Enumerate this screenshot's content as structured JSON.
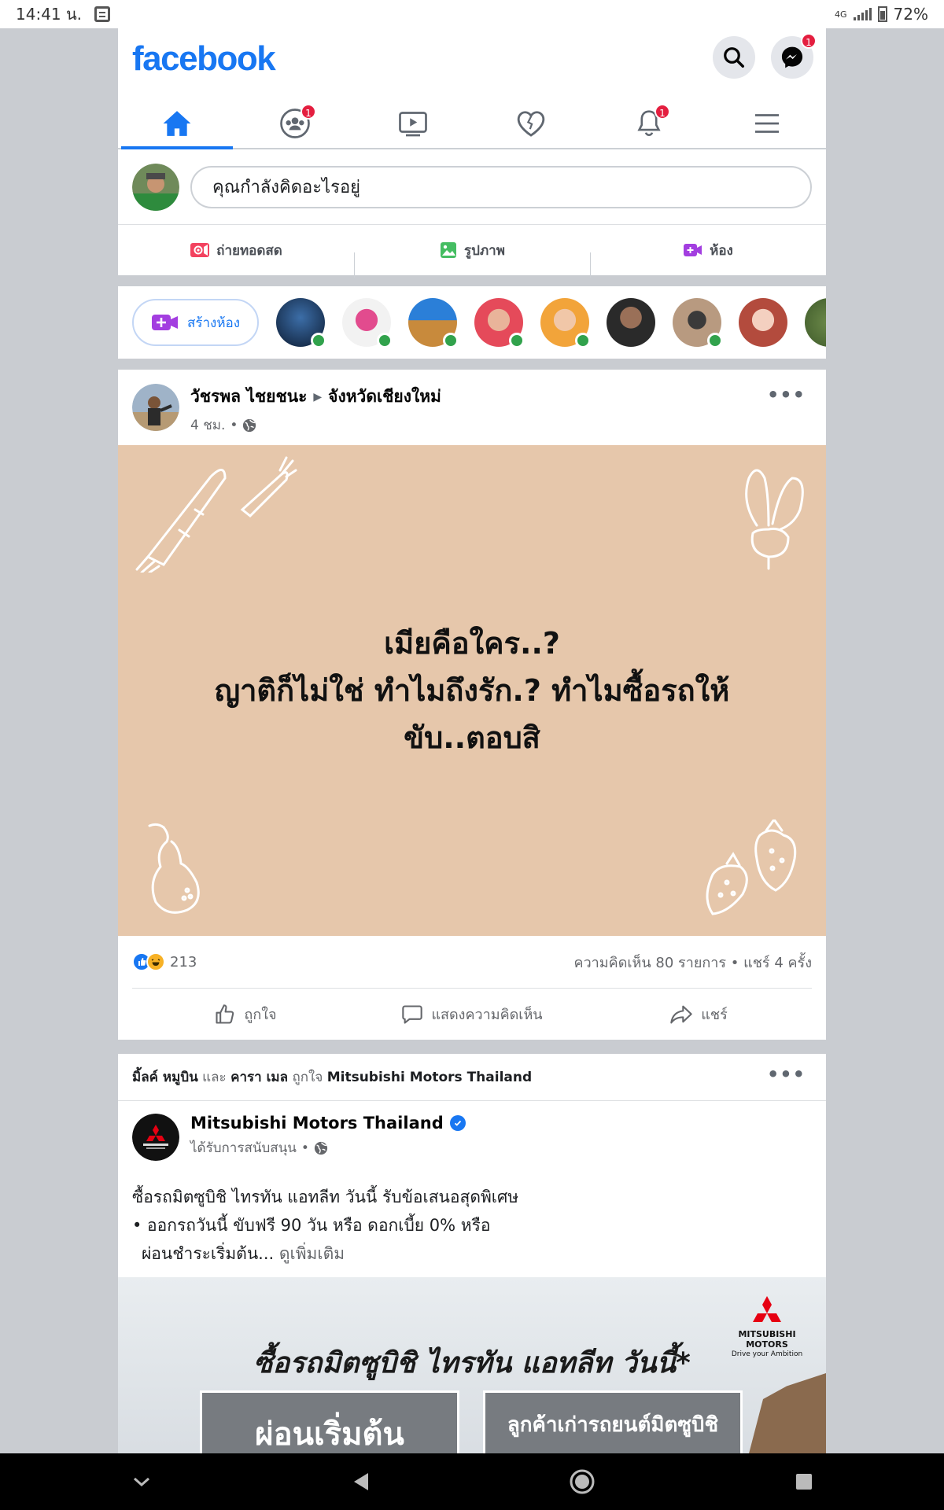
{
  "status_bar": {
    "time": "14:41 น.",
    "network": "4G",
    "battery": "72%"
  },
  "header": {
    "logo": "facebook",
    "messenger_badge": "1",
    "tabs": [
      {
        "name": "home",
        "badge": ""
      },
      {
        "name": "groups",
        "badge": "1"
      },
      {
        "name": "watch",
        "badge": ""
      },
      {
        "name": "dating",
        "badge": ""
      },
      {
        "name": "notifications",
        "badge": "1"
      },
      {
        "name": "menu",
        "badge": ""
      }
    ]
  },
  "composer": {
    "placeholder": "คุณกำลังคิดอะไรอยู่",
    "actions": [
      "ถ่ายทอดสด",
      "รูปภาพ",
      "ห้อง"
    ]
  },
  "rooms": {
    "create_label": "สร้างห้อง"
  },
  "post1": {
    "author": "วัชรพล ไชยชนะ",
    "location": "จังหวัดเชียงใหม่",
    "time": "4 ชม.",
    "text_lines": [
      "เมียคือใคร..?",
      "ญาติก็ไม่ใช่ ทำไมถึงรัก.? ทำไมซื้อรถให้",
      "ขับ..ตอบสิ"
    ],
    "reaction_count": "213",
    "comments_shares": "ความคิดเห็น 80 รายการ • แชร์ 4 ครั้ง",
    "actions": [
      "ถูกใจ",
      "แสดงความคิดเห็น",
      "แชร์"
    ]
  },
  "post2": {
    "liked_by_1": "มิ้ลค์ หมูบิน",
    "liked_by_and": "และ",
    "liked_by_2": "คารา เมล",
    "liked_verb": "ถูกใจ",
    "liked_page": "Mitsubishi Motors Thailand",
    "page_name": "Mitsubishi Motors Thailand",
    "sponsored": "ได้รับการสนับสนุน",
    "body_line1": "ซื้อรถมิตซูบิชิ ไทรทัน แอทลีท วันนี้ รับข้อเสนอสุดพิเศษ",
    "body_line2": "• ออกรถวันนี้ ขับฟรี 90 วัน หรือ ดอกเบี้ย 0% หรือ",
    "body_line3": "ผ่อนชำระเริ่มต้น...",
    "see_more": "ดูเพิ่มเติม",
    "ad_headline": "ซื้อรถมิตซูบิชิ  ไทรทัน แอทลีท วันนี้*",
    "brand_line1": "MITSUBISHI",
    "brand_line2": "MOTORS",
    "brand_tagline": "Drive your Ambition",
    "box1": "ผ่อนเริ่มต้น",
    "box2": "ลูกค้าเก่ารถยนต์มิตซูบิชิ"
  },
  "colors": {
    "brand_blue": "#1877f2",
    "badge_red": "#e41e3f",
    "post_bg": "#e6c7ab",
    "online_green": "#31a24c"
  }
}
